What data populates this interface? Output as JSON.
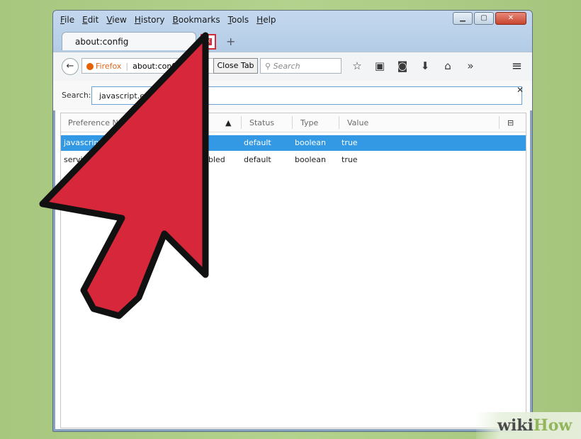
{
  "menubar": {
    "items": [
      "File",
      "Edit",
      "View",
      "History",
      "Bookmarks",
      "Tools",
      "Help"
    ]
  },
  "window_controls": {
    "minimize": "▁",
    "maximize": "▢",
    "close": "✕"
  },
  "tab": {
    "title": "about:config",
    "close_symbol": "✕",
    "new_tab_symbol": "+"
  },
  "navbar": {
    "back_symbol": "←",
    "identity_label": "Firefox",
    "url": "about:config",
    "close_tab_button": "Close Tab",
    "search_placeholder": "Search",
    "toolbar_icons": [
      "star-icon",
      "clipboard-icon",
      "pocket-icon",
      "download-icon",
      "home-icon",
      "overflow-icon"
    ],
    "icon_glyphs": [
      "☆",
      "▣",
      "◙",
      "⬇",
      "⌂",
      "»"
    ],
    "menu_symbol": "≡"
  },
  "filter": {
    "label": "Search:",
    "value": "javascript.enab",
    "clear_symbol": "✕"
  },
  "table": {
    "headers": {
      "preference_name": "Preference Na",
      "sort_indicator": "▲",
      "status": "Status",
      "type": "Type",
      "value": "Value",
      "picker": "⊟"
    },
    "rows": [
      {
        "name": "javascript.e",
        "status": "default",
        "type": "boolean",
        "value": "true",
        "selected": true
      },
      {
        "name": "servic",
        "name_tail": "bled",
        "status": "default",
        "type": "boolean",
        "value": "true",
        "selected": false
      }
    ]
  },
  "overlay": {
    "arrow_color": "#d6283a",
    "arrow_outline": "#111111"
  },
  "watermark": {
    "wiki": "wiki",
    "how": "How"
  }
}
